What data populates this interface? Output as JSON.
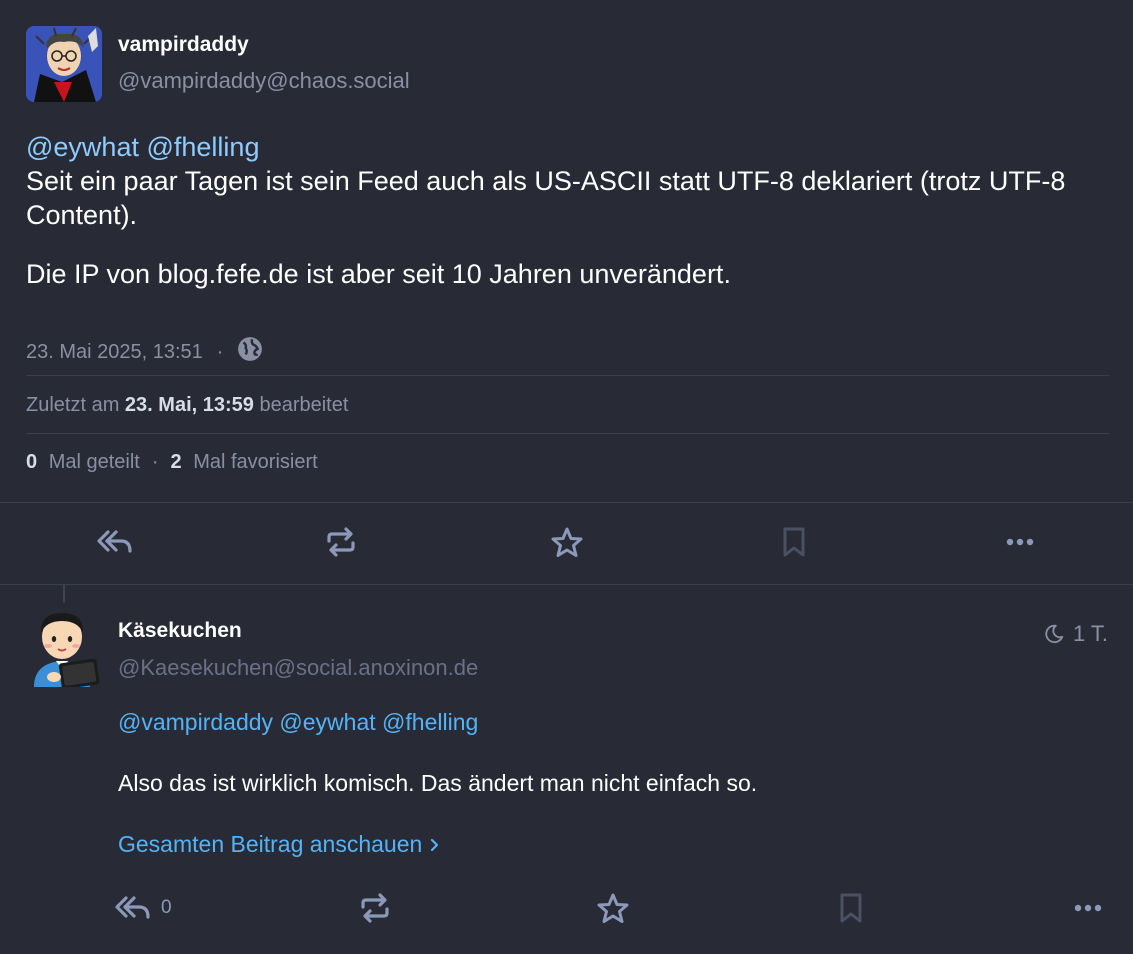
{
  "post": {
    "author_name": "vampirdaddy",
    "author_handle": "@vampirdaddy@chaos.social",
    "mention1": "@eywhat",
    "mention2": "@fhelling",
    "line1": "Seit ein paar Tagen ist sein Feed auch als US-ASCII statt UTF-8 deklariert (trotz UTF-8 Content).",
    "line2": "Die IP von blog.fefe.de ist aber seit 10 Jahren unverändert.",
    "timestamp": "23. Mai 2025, 13:51",
    "separator": "·",
    "visibility_icon": "globe-icon",
    "edited_prefix": "Zuletzt am",
    "edited_date": "23. Mai, 13:59",
    "edited_suffix": "bearbeitet",
    "shares_count": "0",
    "shares_label": "Mal geteilt",
    "favs_count": "2",
    "favs_label": "Mal favorisiert",
    "actions": [
      "reply-all-icon",
      "boost-icon",
      "star-icon",
      "bookmark-icon",
      "more-icon"
    ]
  },
  "reply": {
    "author_name": "Käsekuchen",
    "author_handle": "@Kaesekuchen@social.anoxinon.de",
    "time": "1 T.",
    "time_icon": "moon-icon",
    "mentions": [
      "@vampirdaddy",
      "@eywhat",
      "@fhelling"
    ],
    "body": "Also das ist wirklich komisch. Das ändert man nicht einfach so.",
    "view_full": "Gesamten Beitrag anschauen",
    "reply_count": "0"
  },
  "colors": {
    "background": "#282b36",
    "muted": "#8a8fa3",
    "mention": "#8ecbff",
    "link": "#55b3f5",
    "icon": "#8c99b8"
  }
}
